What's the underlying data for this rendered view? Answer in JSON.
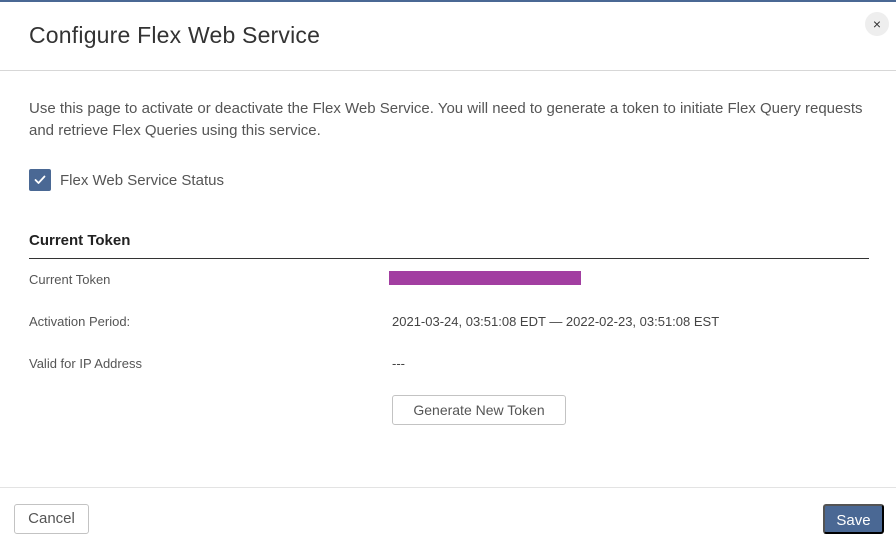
{
  "dialog": {
    "title": "Configure Flex Web Service",
    "close_label": "×"
  },
  "intro": {
    "text": "Use this page to activate or deactivate the Flex Web Service. You will need to generate a token to initiate Flex Query requests and retrieve Flex Queries using this service."
  },
  "status": {
    "label": "Flex Web Service Status",
    "checked": true
  },
  "token_section": {
    "title": "Current Token",
    "rows": [
      {
        "label": "Current Token",
        "value": ""
      },
      {
        "label": "Activation Period:",
        "value": "2021-03-24, 03:51:08 EDT — 2022-02-23, 03:51:08 EST"
      },
      {
        "label": "Valid for IP Address",
        "value": "---"
      }
    ],
    "token_redaction_color": "#a23ea1",
    "generate_button": "Generate New Token"
  },
  "footer": {
    "cancel_label": "Cancel",
    "save_label": "Save"
  },
  "colors": {
    "accent": "#4a6894"
  }
}
